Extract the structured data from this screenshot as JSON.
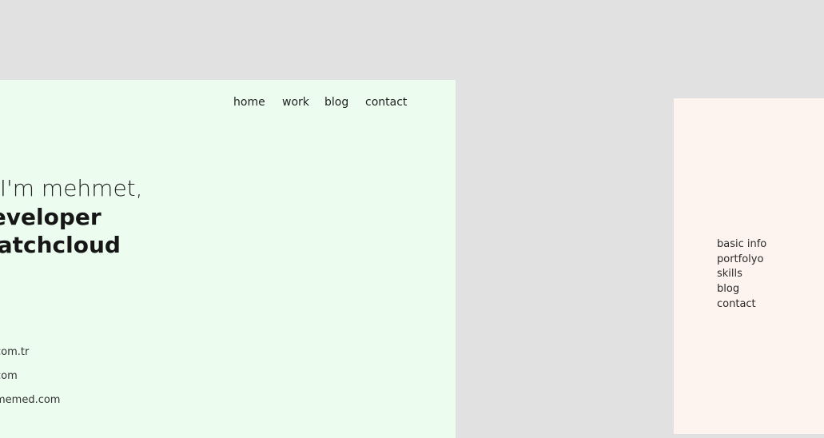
{
  "nav": {
    "home": "home",
    "work": "work",
    "blog": "blog",
    "contact": "contact"
  },
  "hero": {
    "greeting": ", I'm mehmet,",
    "role": "end developer",
    "company": "spatchcloud"
  },
  "links": [
    "com.tr",
    "com",
    "memed.com"
  ],
  "side_menu": [
    "basic info",
    "portfolyo",
    "skills",
    "blog",
    "contact"
  ],
  "colors": {
    "background": "#e1e1e1",
    "left_panel": "#ecfdf0",
    "right_panel": "#fdf3ef",
    "wave_emoji": "#f5c542"
  }
}
